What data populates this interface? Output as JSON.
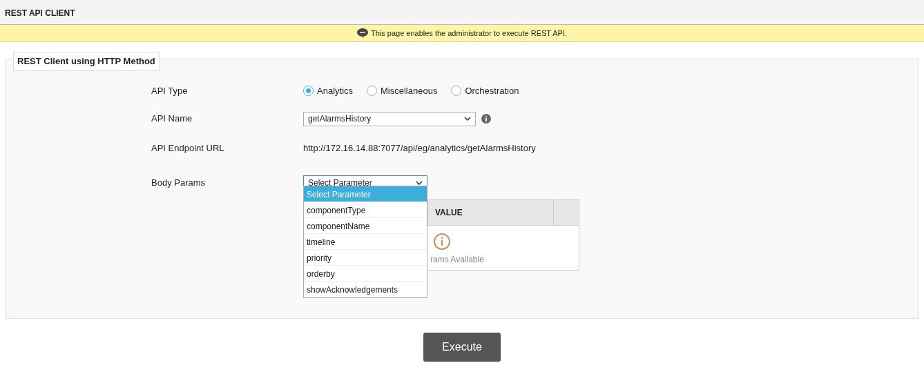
{
  "header": {
    "title": "REST API CLIENT"
  },
  "notice": {
    "text": "This page enables the administrator to execute REST API."
  },
  "panel": {
    "legend": "REST Client using HTTP Method"
  },
  "form": {
    "api_type": {
      "label": "API Type",
      "options": [
        {
          "label": "Analytics",
          "selected": true
        },
        {
          "label": "Miscellaneous",
          "selected": false
        },
        {
          "label": "Orchestration",
          "selected": false
        }
      ]
    },
    "api_name": {
      "label": "API Name",
      "value": "getAlarmsHistory"
    },
    "endpoint": {
      "label": "API Endpoint URL",
      "value": "http://172.16.14.88:7077/api/eg/analytics/getAlarmsHistory"
    },
    "body_params": {
      "label": "Body Params",
      "value": "Select Parameter",
      "expanded": true,
      "options": [
        {
          "label": "Select Parameter",
          "selected": true
        },
        {
          "label": "componentType",
          "selected": false
        },
        {
          "label": "componentName",
          "selected": false
        },
        {
          "label": "timeline",
          "selected": false
        },
        {
          "label": "priority",
          "selected": false
        },
        {
          "label": "orderby",
          "selected": false
        },
        {
          "label": "showAcknowledgements",
          "selected": false
        }
      ]
    }
  },
  "params_table": {
    "columns": [
      "VALUE"
    ],
    "empty_text": "rams Available"
  },
  "buttons": [
    {
      "label": "Execute"
    }
  ]
}
